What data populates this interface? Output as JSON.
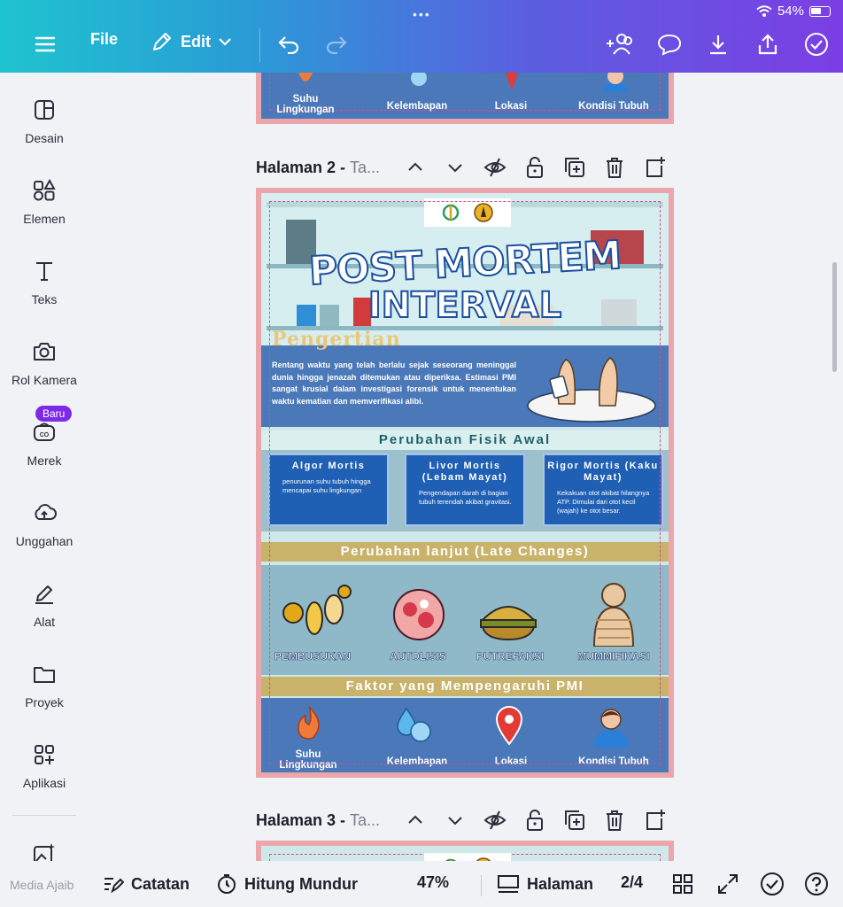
{
  "status": {
    "battery": "54%"
  },
  "toolbar": {
    "file": "File",
    "edit": "Edit"
  },
  "sidebar": {
    "items": [
      {
        "label": "Desain"
      },
      {
        "label": "Elemen"
      },
      {
        "label": "Teks"
      },
      {
        "label": "Rol Kamera"
      },
      {
        "label": "Merek"
      },
      {
        "label": "Unggahan"
      },
      {
        "label": "Alat"
      },
      {
        "label": "Proyek"
      },
      {
        "label": "Aplikasi"
      },
      {
        "label": "Media Ajaib"
      }
    ],
    "new_badge": "Baru"
  },
  "pages": {
    "page2_title": "Halaman 2 - ",
    "page2_sub": "Ta...",
    "page3_title": "Halaman 3 - ",
    "page3_sub": "Ta..."
  },
  "infographic": {
    "title_line1": "POST MORTEM",
    "title_line2": "INTERVAL",
    "def_title": "Pengertian",
    "def_text": "Rentang waktu yang telah berlalu sejak seseorang meninggal dunia hingga jenazah ditemukan atau diperiksa. Estimasi PMI sangat krusial dalam investigasi forensik untuk menentukan waktu kematian dan memverifikasi alibi.",
    "section_early": "Perubahan Fisik Awal",
    "boxes": [
      {
        "title": "Algor Mortis",
        "text": "penurunan suhu tubuh hingga mencapai suhu lingkungan"
      },
      {
        "title": "Livor Mortis (Lebam Mayat)",
        "text": "Pengendapan darah di bagian tubuh terendah akibat gravitasi."
      },
      {
        "title": "Rigor Mortis (Kaku Mayat)",
        "text": "Kekakuan otot akibat hilangnya ATP. Dimulai dari otot kecil (wajah) ke otot besar."
      }
    ],
    "section_late": "Perubahan lanjut (Late Changes)",
    "late_items": [
      "PEMBUSUKAN",
      "AUTOLISIS",
      "PUTREFAKSI",
      "MUMMIFIKASI"
    ],
    "section_factors": "Faktor yang Mempengaruhi PMI",
    "factors": [
      "Suhu Lingkungan",
      "Kelembapan",
      "Lokasi",
      "Kondisi Tubuh"
    ]
  },
  "bottombar": {
    "notes": "Catatan",
    "timer": "Hitung Mundur",
    "zoom": "47%",
    "pages": "Halaman",
    "page_count": "2/4"
  }
}
